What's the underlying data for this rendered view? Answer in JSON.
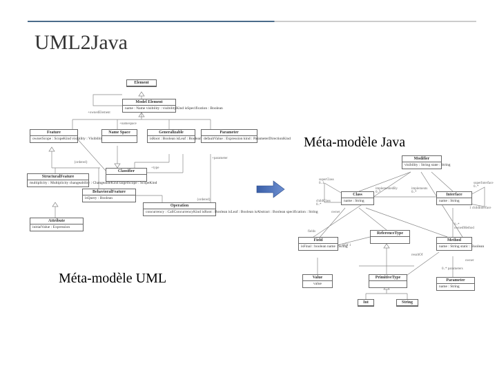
{
  "slide": {
    "title": "UML2Java",
    "label_java": "Méta-modèle Java",
    "label_uml": "Méta-modèle UML"
  },
  "uml": {
    "element": "Element",
    "model_element": {
      "name": "Model Element",
      "attrs": "name : Name\nvisibility : visibilityKind\nisSpecification : Boolean"
    },
    "owned_element": "+ownedElement",
    "namespace_role": "+namespace",
    "feature": {
      "name": "Feature",
      "attrs": "ownerScope : ScopeKind\nvisibility : VisibilityKind"
    },
    "namespace": "Name Space",
    "generalizable": {
      "name": "Generalizable",
      "attrs": "isRoot : Boolean\nisLeaf : Boolean\nisAbstract : Boolean"
    },
    "parameter": {
      "name": "Parameter",
      "attrs": "defaultValue : Expression\nkind : ParameterDirectionKind"
    },
    "parameter_role": "+parameter",
    "ordered1": "{ordered}",
    "classifier": "Classifier",
    "type_role": "+type",
    "structural": {
      "name": "StructuralFeature",
      "attrs": "multiplicity : Multiplicity\nchangeability : ChangeableKind\ntargetScope : ScopeKind"
    },
    "behavioral": {
      "name": "BehavioralFeature",
      "attrs": "isQuery : Boolean"
    },
    "ordered2": "{ordered}",
    "operation": {
      "name": "Operation",
      "attrs": "concurrency : CallConcurrencyKind\nisRoot : Boolean\nisLeaf : Boolean\nisAbstract : Boolean\nspecification : String"
    },
    "attribute": {
      "name": "Attribute",
      "attrs": "initialValue : Expression"
    }
  },
  "java": {
    "modifier": {
      "name": "Modifier",
      "attrs": "visibility : String\nstate : String"
    },
    "class": {
      "name": "Class",
      "attrs": "name : String"
    },
    "interface": {
      "name": "Interface",
      "attrs": "name : String"
    },
    "superclass": "superClass\n0..1",
    "childclass": "childClass\n0..*",
    "implementedby": "implementedBy\n0..*",
    "implements": "implements\n0..*",
    "superinterface": "superInterface\n0..*",
    "childinterface": "1  childInterface",
    "owner": "owner",
    "fields": "fields",
    "field": {
      "name": "Field",
      "attrs": "isFinal : boolean\nname : String"
    },
    "reference": "ReferenceType",
    "method": {
      "name": "Method",
      "attrs": "name : String\nstatic : Boolean"
    },
    "ownedmethod": "0..*\nownedMethod",
    "isof": "isOf   1",
    "resultof": "resultOf",
    "value": {
      "name": "Value",
      "attrs": "value"
    },
    "primitive": "PrimitiveType",
    "int": "Int",
    "string": "String",
    "parameter": {
      "name": "Parameter",
      "attrs": "name : String"
    },
    "parameters": "0..*   parameters",
    "owner2": "owner"
  }
}
